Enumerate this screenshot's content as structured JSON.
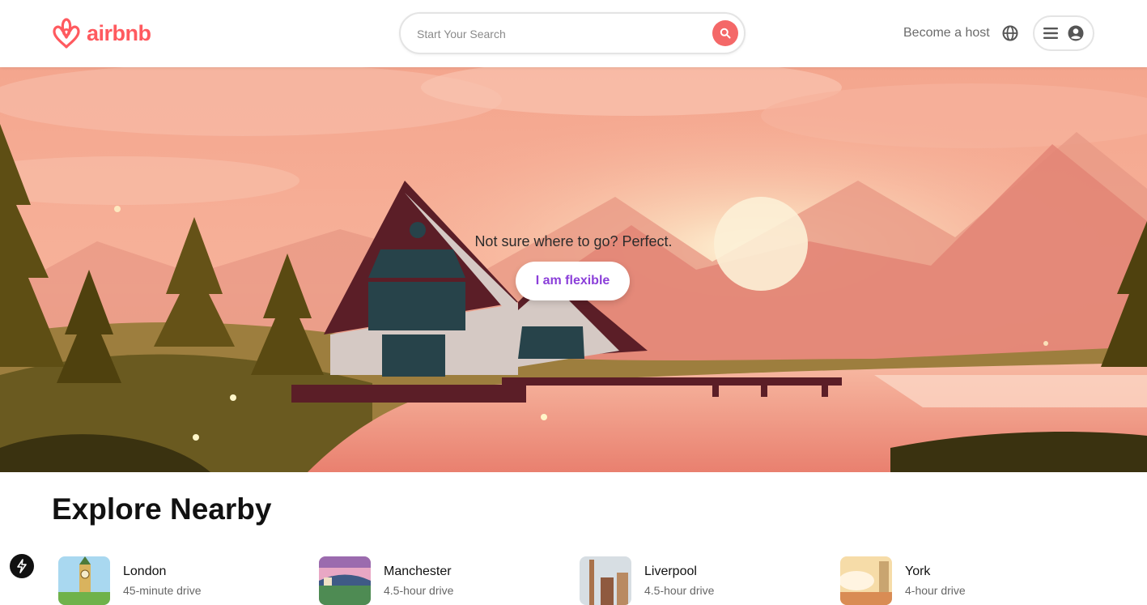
{
  "header": {
    "logo_text": "airbnb",
    "search": {
      "placeholder": "Start Your Search",
      "value": ""
    },
    "host_link": "Become a host",
    "icons": {
      "globe": "globe-icon",
      "menu": "hamburger-menu-icon",
      "profile": "user-circle-icon",
      "search": "search-icon"
    }
  },
  "hero": {
    "tagline": "Not sure where to go? Perfect.",
    "cta_label": "I am flexible"
  },
  "explore": {
    "title": "Explore Nearby",
    "items": [
      {
        "name": "London",
        "distance": "45-minute drive"
      },
      {
        "name": "Manchester",
        "distance": "4.5-hour drive"
      },
      {
        "name": "Liverpool",
        "distance": "4.5-hour drive"
      },
      {
        "name": "York",
        "distance": "4-hour drive"
      }
    ]
  },
  "colors": {
    "brand": "#FF5A5F",
    "search_button": "#F46868",
    "cta_text": "#8B3FD9"
  },
  "floating_badge": {
    "icon": "lightning-bolt-icon"
  }
}
